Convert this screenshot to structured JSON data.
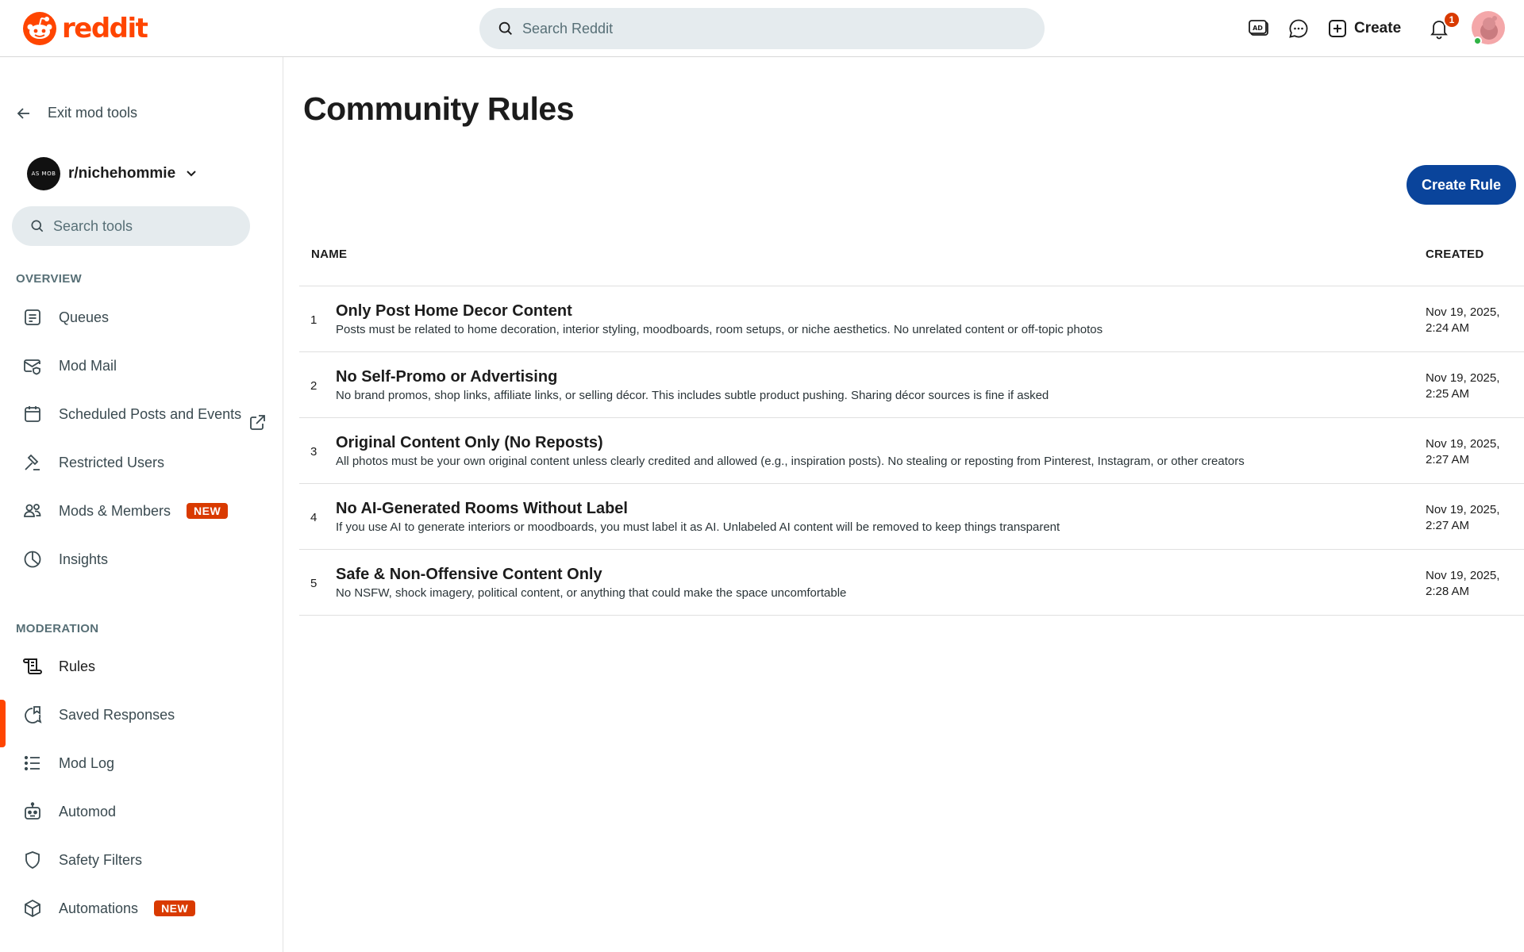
{
  "header": {
    "logo_text": "reddit",
    "search_placeholder": "Search Reddit",
    "create_label": "Create",
    "notification_count": "1",
    "brand_color": "#ff4500"
  },
  "sidebar": {
    "exit_label": "Exit mod tools",
    "subreddit": {
      "name": "r/nichehommie",
      "avatar_text": "AS MOB"
    },
    "search_placeholder": "Search tools",
    "sections": [
      {
        "label": "OVERVIEW",
        "items": [
          {
            "label": "Queues",
            "icon": "queue-icon"
          },
          {
            "label": "Mod Mail",
            "icon": "mail-icon",
            "external_icon": "external-link-icon"
          },
          {
            "label": "Scheduled Posts and Events",
            "icon": "calendar-icon"
          },
          {
            "label": "Restricted Users",
            "icon": "hammer-icon"
          },
          {
            "label": "Mods & Members",
            "icon": "members-icon",
            "badge": "NEW"
          },
          {
            "label": "Insights",
            "icon": "pie-chart-icon"
          }
        ]
      },
      {
        "label": "MODERATION",
        "items": [
          {
            "label": "Rules",
            "icon": "rules-scroll-icon",
            "active": true
          },
          {
            "label": "Saved Responses",
            "icon": "saved-response-icon"
          },
          {
            "label": "Mod Log",
            "icon": "list-icon"
          },
          {
            "label": "Automod",
            "icon": "robot-icon"
          },
          {
            "label": "Safety Filters",
            "icon": "shield-icon"
          },
          {
            "label": "Automations",
            "icon": "cube-icon",
            "badge": "NEW"
          }
        ]
      }
    ],
    "accent_color": "#ff4500",
    "badge_color": "#d93a00"
  },
  "main": {
    "title": "Community Rules",
    "create_rule_label": "Create Rule",
    "create_rule_color": "#0a449b",
    "columns": {
      "name": "NAME",
      "created": "CREATED"
    },
    "rules": [
      {
        "number": "1",
        "title": "Only Post Home Decor Content",
        "description": "Posts must be related to home decoration, interior styling, moodboards, room setups, or niche aesthetics. No unrelated content or off-topic photos",
        "date": "Nov 19, 2025,",
        "time": "2:24 AM"
      },
      {
        "number": "2",
        "title": "No Self-Promo or Advertising",
        "description": "No brand promos, shop links, affiliate links, or selling décor. This includes subtle product pushing. Sharing décor sources is fine if asked",
        "date": "Nov 19, 2025,",
        "time": "2:25 AM"
      },
      {
        "number": "3",
        "title": "Original Content Only (No Reposts)",
        "description": "All photos must be your own original content unless clearly credited and allowed (e.g., inspiration posts). No stealing or reposting from Pinterest, Instagram, or other creators",
        "date": "Nov 19, 2025,",
        "time": "2:27 AM"
      },
      {
        "number": "4",
        "title": "No AI-Generated Rooms Without Label",
        "description": "If you use AI to generate interiors or moodboards, you must label it as AI. Unlabeled AI content will be removed to keep things transparent",
        "date": "Nov 19, 2025,",
        "time": "2:27 AM"
      },
      {
        "number": "5",
        "title": "Safe & Non-Offensive Content Only",
        "description": "No NSFW, shock imagery, political content, or anything that could make the space uncomfortable",
        "date": "Nov 19, 2025,",
        "time": "2:28 AM"
      }
    ]
  }
}
